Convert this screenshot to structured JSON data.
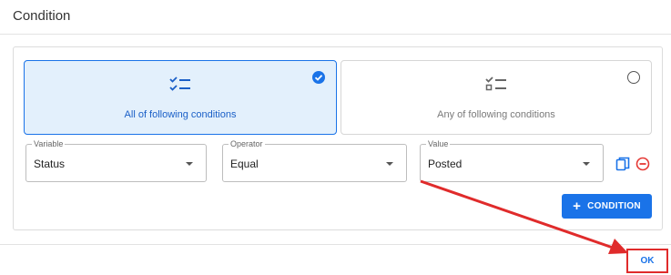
{
  "dialog": {
    "title": "Condition"
  },
  "mode_cards": {
    "all": {
      "label": "All of following conditions",
      "icon": "checklist-icon",
      "selected": true
    },
    "any": {
      "label": "Any of following conditions",
      "icon": "checklist-icon",
      "selected": false
    }
  },
  "condition_row": {
    "variable": {
      "label": "Variable",
      "value": "Status"
    },
    "operator": {
      "label": "Operator",
      "value": "Equal"
    },
    "value": {
      "label": "Value",
      "value": "Posted"
    }
  },
  "actions": {
    "add_condition_label": "CONDITION"
  },
  "footer": {
    "ok_label": "OK"
  },
  "colors": {
    "accent": "#1a73e8",
    "selected_bg": "#e3f0fc",
    "remove": "#e53935",
    "annotation": "#e02b2b"
  }
}
